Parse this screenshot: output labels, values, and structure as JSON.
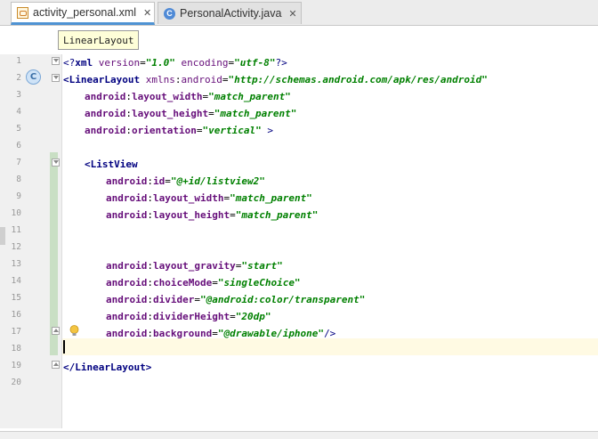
{
  "tabs": [
    {
      "label": "activity_personal.xml",
      "icon": "xml-file-icon",
      "active": true
    },
    {
      "label": "PersonalActivity.java",
      "icon": "java-class-icon",
      "active": false
    }
  ],
  "close_glyph": "✕",
  "breadcrumb": {
    "label": "LinearLayout"
  },
  "line_numbers": [
    "1",
    "2",
    "3",
    "4",
    "5",
    "6",
    "7",
    "8",
    "9",
    "10",
    "11",
    "12",
    "13",
    "14",
    "15",
    "16",
    "17",
    "18",
    "19",
    "20"
  ],
  "code": {
    "l1": {
      "open": "<?",
      "tag": "xml",
      "a1": "version",
      "eq1": "=",
      "v1": "\"1.0\"",
      "a2": "encoding",
      "eq2": "=",
      "v2": "\"utf-8\"",
      "close": "?>"
    },
    "l2": {
      "open": "<",
      "tag": "LinearLayout",
      "ns": "xmlns",
      "colon": ":",
      "attr": "android",
      "eq": "=",
      "val": "\"http://schemas.android.com/apk/res/android\""
    },
    "l3": {
      "ns": "android",
      "colon": ":",
      "attr": "layout_width",
      "eq": "=",
      "val": "\"match_parent\""
    },
    "l4": {
      "ns": "android",
      "colon": ":",
      "attr": "layout_height",
      "eq": "=",
      "val": "\"match_parent\""
    },
    "l5": {
      "ns": "android",
      "colon": ":",
      "attr": "orientation",
      "eq": "=",
      "val": "\"vertical\"",
      "close": " >"
    },
    "l7": {
      "open": "<",
      "tag": "ListView"
    },
    "l8": {
      "ns": "android",
      "colon": ":",
      "attr": "id",
      "eq": "=",
      "val": "\"@+id/listview2\""
    },
    "l9": {
      "ns": "android",
      "colon": ":",
      "attr": "layout_width",
      "eq": "=",
      "val": "\"match_parent\""
    },
    "l10": {
      "ns": "android",
      "colon": ":",
      "attr": "layout_height",
      "eq": "=",
      "val": "\"match_parent\""
    },
    "l13": {
      "ns": "android",
      "colon": ":",
      "attr": "layout_gravity",
      "eq": "=",
      "val": "\"start\""
    },
    "l14": {
      "ns": "android",
      "colon": ":",
      "attr": "choiceMode",
      "eq": "=",
      "val": "\"singleChoice\""
    },
    "l15": {
      "ns": "android",
      "colon": ":",
      "attr": "divider",
      "eq": "=",
      "val": "\"@android:color/transparent\""
    },
    "l16": {
      "ns": "android",
      "colon": ":",
      "attr": "dividerHeight",
      "eq": "=",
      "val": "\"20dp\""
    },
    "l17": {
      "ns": "android",
      "colon": ":",
      "attr": "background",
      "eq": "=",
      "val": "\"@drawable/iphone\"",
      "close": "/>"
    },
    "l19": {
      "open": "</",
      "tag": "LinearLayout",
      "close": ">"
    }
  },
  "colors": {
    "tag": "#000080",
    "attribute": "#660e7a",
    "value": "#008000",
    "caret_line": "#fffae3",
    "active_tab_underline": "#4f93d3"
  }
}
